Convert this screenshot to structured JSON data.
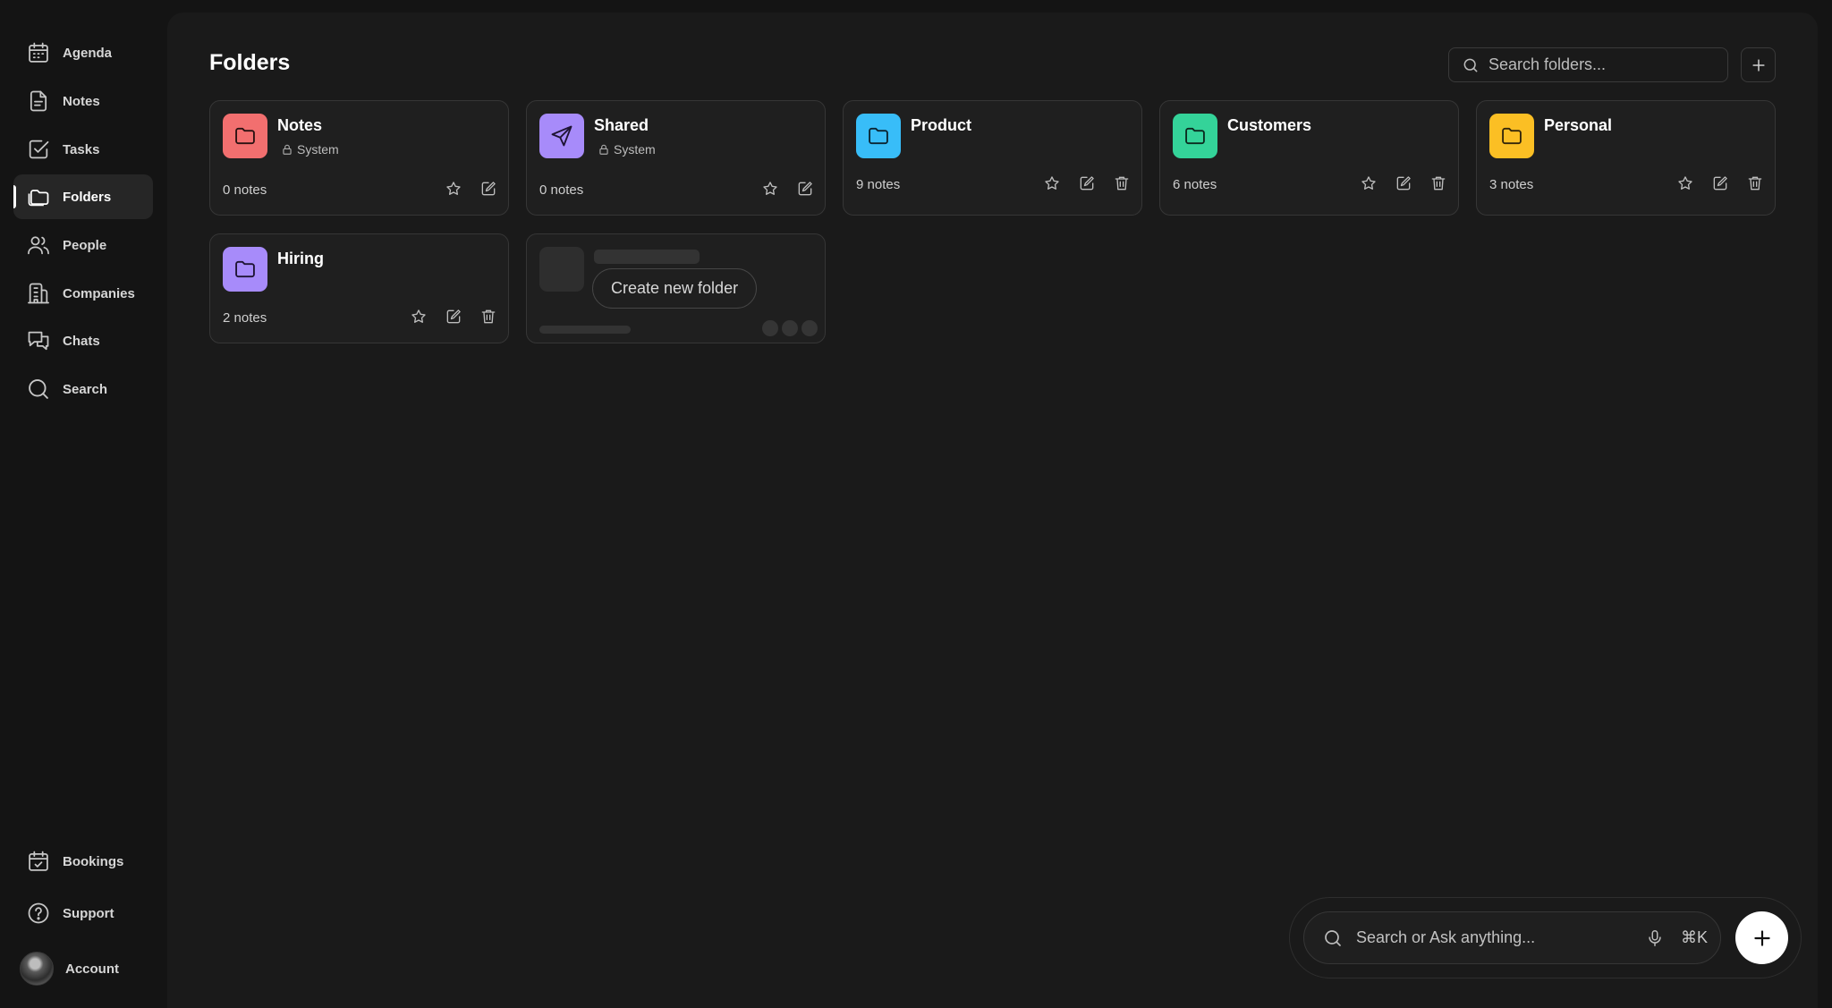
{
  "sidebar": {
    "items": [
      {
        "key": "agenda",
        "label": "Agenda",
        "icon": "calendar-icon"
      },
      {
        "key": "notes",
        "label": "Notes",
        "icon": "document-icon"
      },
      {
        "key": "tasks",
        "label": "Tasks",
        "icon": "checkbox-icon"
      },
      {
        "key": "folders",
        "label": "Folders",
        "icon": "folders-icon",
        "active": true
      },
      {
        "key": "people",
        "label": "People",
        "icon": "people-icon"
      },
      {
        "key": "companies",
        "label": "Companies",
        "icon": "building-icon"
      },
      {
        "key": "chats",
        "label": "Chats",
        "icon": "chat-icon"
      },
      {
        "key": "search",
        "label": "Search",
        "icon": "search-icon"
      }
    ],
    "bottom": [
      {
        "key": "bookings",
        "label": "Bookings",
        "icon": "calendar-check-icon"
      },
      {
        "key": "support",
        "label": "Support",
        "icon": "help-icon"
      },
      {
        "key": "account",
        "label": "Account",
        "icon": "avatar"
      }
    ]
  },
  "header": {
    "title": "Folders",
    "search_placeholder": "Search folders...",
    "add_icon": "plus-icon"
  },
  "folders": [
    {
      "name": "Notes",
      "system": true,
      "system_label": "System",
      "count": "0 notes",
      "color": "#f26f6f",
      "icon": "folder-icon"
    },
    {
      "name": "Shared",
      "system": true,
      "system_label": "System",
      "count": "0 notes",
      "color": "#a78bfa",
      "icon": "send-icon"
    },
    {
      "name": "Product",
      "system": false,
      "count": "9 notes",
      "color": "#38bdf8",
      "icon": "folder-icon"
    },
    {
      "name": "Customers",
      "system": false,
      "count": "6 notes",
      "color": "#34d399",
      "icon": "folder-icon"
    },
    {
      "name": "Personal",
      "system": false,
      "count": "3 notes",
      "color": "#fbbf24",
      "icon": "folder-icon"
    },
    {
      "name": "Hiring",
      "system": false,
      "count": "2 notes",
      "color": "#a78bfa",
      "icon": "folder-icon"
    }
  ],
  "create_card": {
    "label": "Create new folder"
  },
  "ask_bar": {
    "placeholder": "Search or Ask anything...",
    "shortcut": "⌘K",
    "mic_icon": "mic-icon",
    "fab_icon": "plus-icon"
  }
}
